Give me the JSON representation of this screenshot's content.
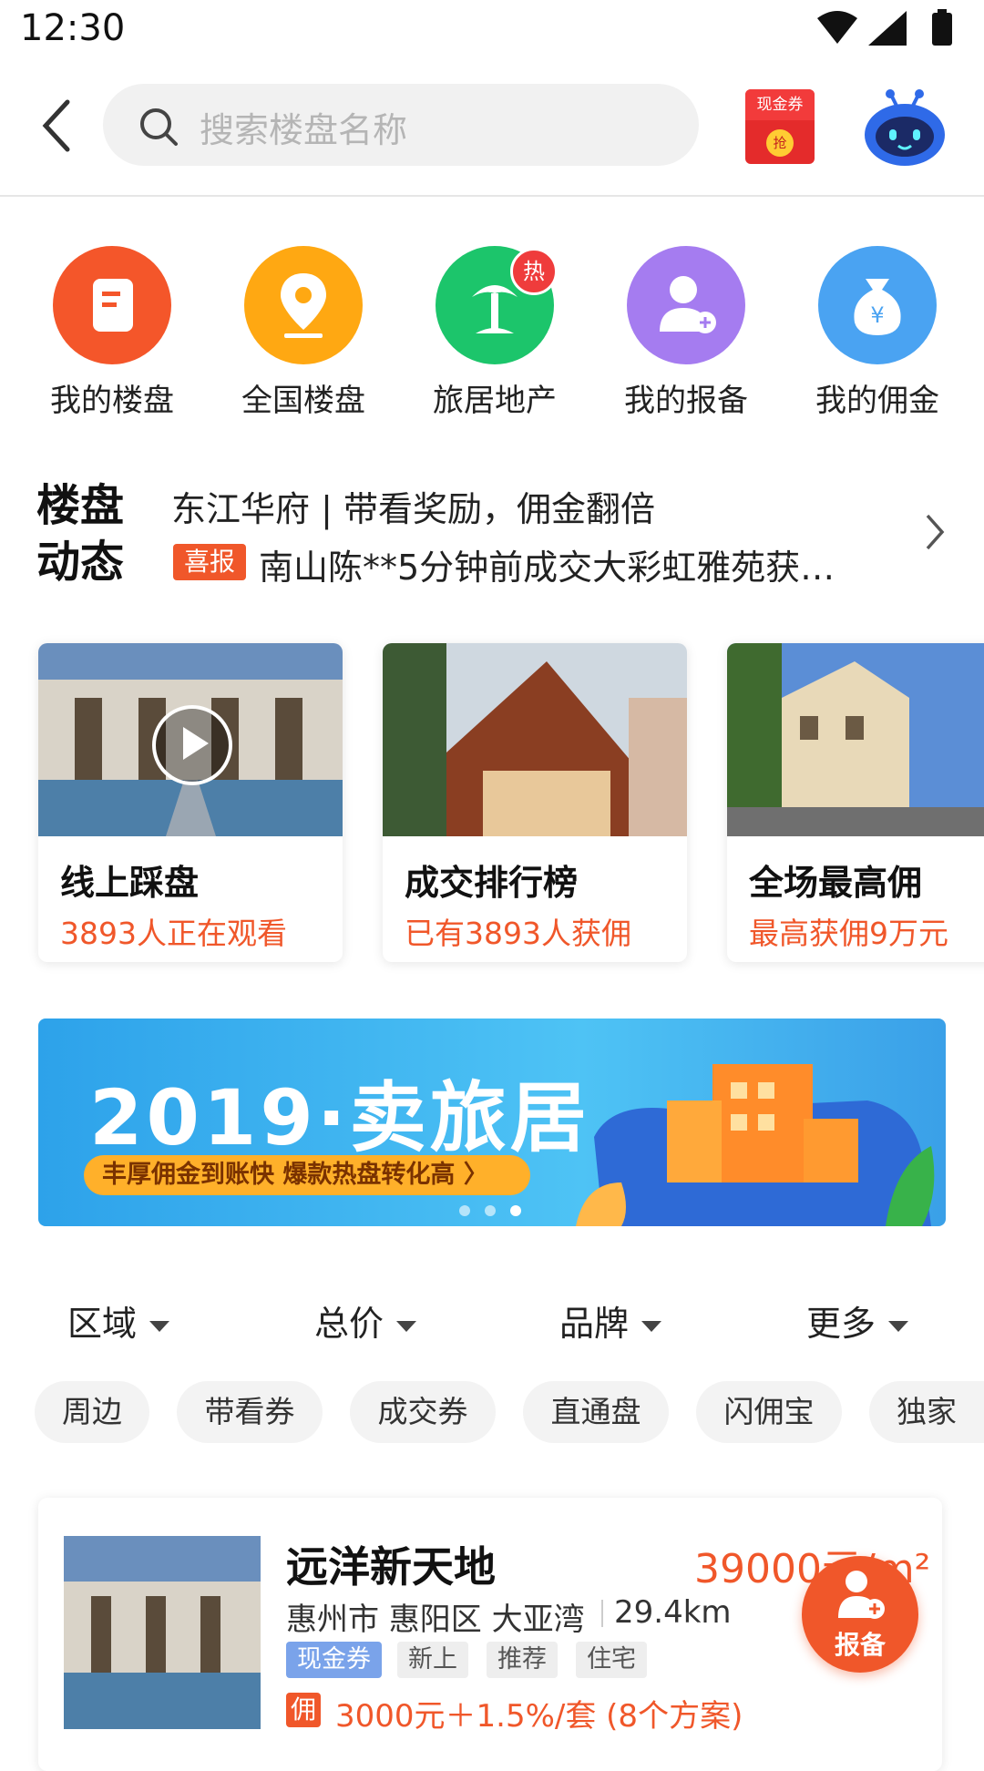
{
  "status_bar": {
    "time": "12:30"
  },
  "header": {
    "search_placeholder": "搜索楼盘名称",
    "cash_coupon_label": "现金券",
    "cash_coupon_action": "抢"
  },
  "menu": [
    {
      "label": "我的楼盘",
      "icon": "document-icon",
      "color": "#f4562a"
    },
    {
      "label": "全国楼盘",
      "icon": "location-pin-icon",
      "color": "#ffa812"
    },
    {
      "label": "旅居地产",
      "icon": "palm-tree-icon",
      "color": "#1cc56b",
      "badge": "热"
    },
    {
      "label": "我的报备",
      "icon": "user-add-icon",
      "color": "#a57cf0"
    },
    {
      "label": "我的佣金",
      "icon": "money-bag-icon",
      "color": "#4aa3f2"
    }
  ],
  "news": {
    "title_line1": "楼盘",
    "title_line2": "动态",
    "line1": "东江华府 | 带看奖励，佣金翻倍",
    "badge": "喜报",
    "line2": "南山陈**5分钟前成交大彩虹雅苑获…"
  },
  "cards": [
    {
      "title": "线上踩盘",
      "subtitle": "3893人正在观看"
    },
    {
      "title": "成交排行榜",
      "subtitle": "已有3893人获佣"
    },
    {
      "title": "全场最高佣",
      "subtitle": "最高获佣9万元"
    }
  ],
  "banner": {
    "title": "2019·卖旅居",
    "slogan": "丰厚佣金到账快  爆款热盘转化高 〉",
    "page_index": 3,
    "page_count": 3
  },
  "filters": [
    "区域",
    "总价",
    "品牌",
    "更多"
  ],
  "chips": [
    "周边",
    "带看券",
    "成交券",
    "直通盘",
    "闪佣宝",
    "独家"
  ],
  "listing": {
    "name": "远洋新天地",
    "price": "39000元/m²",
    "address": "惠州市 惠阳区 大亚湾",
    "distance": "29.4km",
    "tags": [
      "现金券",
      "新上",
      "推荐",
      "住宅"
    ],
    "commission_badge": "佣",
    "commission": "3000元＋1.5%/套 (8个方案)"
  },
  "fab": {
    "label": "报备"
  }
}
